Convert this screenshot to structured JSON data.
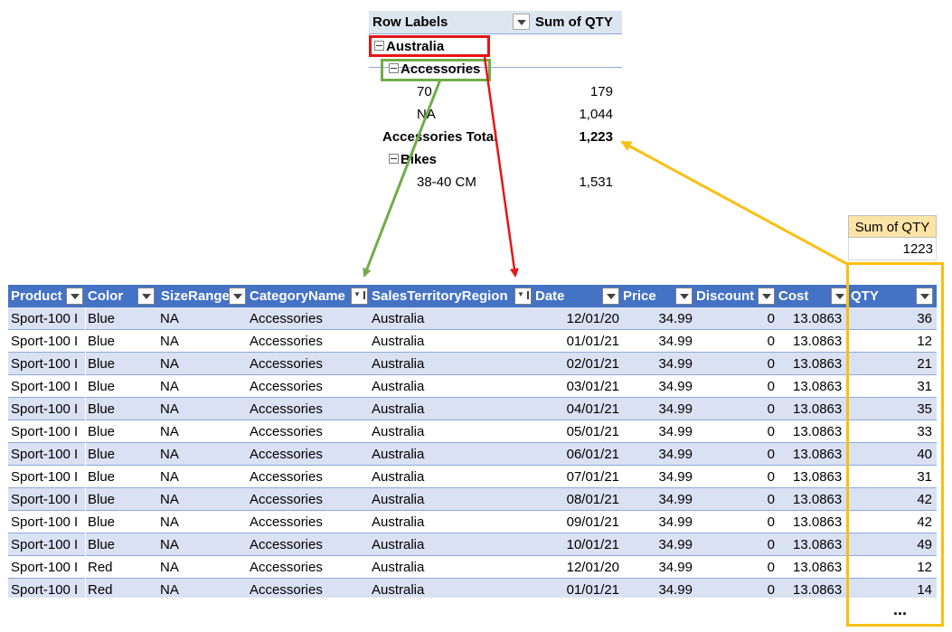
{
  "pivot": {
    "header_label": "Row Labels",
    "header_sum": "Sum of QTY",
    "rows": [
      {
        "label": "Australia",
        "value": ""
      },
      {
        "label": "Accessories",
        "value": ""
      },
      {
        "label": "70",
        "value": "179"
      },
      {
        "label": "NA",
        "value": "1,044"
      },
      {
        "label": "Accessories Total",
        "value": "1,223"
      },
      {
        "label": "Bikes",
        "value": ""
      },
      {
        "label": "38-40 CM",
        "value": "1,531"
      }
    ]
  },
  "sum_box": {
    "header": "Sum of QTY",
    "value": "1223"
  },
  "table": {
    "columns": [
      "Product",
      "Color",
      "SizeRange",
      "CategoryName",
      "SalesTerritoryRegion",
      "Date",
      "Price",
      "Discount",
      "Cost",
      "QTY"
    ],
    "rows": [
      [
        "Sport-100 I",
        "Blue",
        "NA",
        "Accessories",
        "Australia",
        "12/01/20",
        "34.99",
        "0",
        "13.0863",
        "36"
      ],
      [
        "Sport-100 I",
        "Blue",
        "NA",
        "Accessories",
        "Australia",
        "01/01/21",
        "34.99",
        "0",
        "13.0863",
        "12"
      ],
      [
        "Sport-100 I",
        "Blue",
        "NA",
        "Accessories",
        "Australia",
        "02/01/21",
        "34.99",
        "0",
        "13.0863",
        "21"
      ],
      [
        "Sport-100 I",
        "Blue",
        "NA",
        "Accessories",
        "Australia",
        "03/01/21",
        "34.99",
        "0",
        "13.0863",
        "31"
      ],
      [
        "Sport-100 I",
        "Blue",
        "NA",
        "Accessories",
        "Australia",
        "04/01/21",
        "34.99",
        "0",
        "13.0863",
        "35"
      ],
      [
        "Sport-100 I",
        "Blue",
        "NA",
        "Accessories",
        "Australia",
        "05/01/21",
        "34.99",
        "0",
        "13.0863",
        "33"
      ],
      [
        "Sport-100 I",
        "Blue",
        "NA",
        "Accessories",
        "Australia",
        "06/01/21",
        "34.99",
        "0",
        "13.0863",
        "40"
      ],
      [
        "Sport-100 I",
        "Blue",
        "NA",
        "Accessories",
        "Australia",
        "07/01/21",
        "34.99",
        "0",
        "13.0863",
        "31"
      ],
      [
        "Sport-100 I",
        "Blue",
        "NA",
        "Accessories",
        "Australia",
        "08/01/21",
        "34.99",
        "0",
        "13.0863",
        "42"
      ],
      [
        "Sport-100 I",
        "Blue",
        "NA",
        "Accessories",
        "Australia",
        "09/01/21",
        "34.99",
        "0",
        "13.0863",
        "42"
      ],
      [
        "Sport-100 I",
        "Blue",
        "NA",
        "Accessories",
        "Australia",
        "10/01/21",
        "34.99",
        "0",
        "13.0863",
        "49"
      ],
      [
        "Sport-100 I",
        "Red",
        "NA",
        "Accessories",
        "Australia",
        "12/01/20",
        "34.99",
        "0",
        "13.0863",
        "12"
      ],
      [
        "Sport-100 I",
        "Red",
        "NA",
        "Accessories",
        "Australia",
        "01/01/21",
        "34.99",
        "0",
        "13.0863",
        "14"
      ]
    ]
  },
  "ellipsis": "...",
  "colors": {
    "header_blue": "#4472c4",
    "band_blue": "#d9e1f2",
    "highlight_red": "#e81416",
    "highlight_green": "#70ad47",
    "highlight_yellow": "#fbbf13",
    "sum_header_fill": "#fbe4a6"
  }
}
